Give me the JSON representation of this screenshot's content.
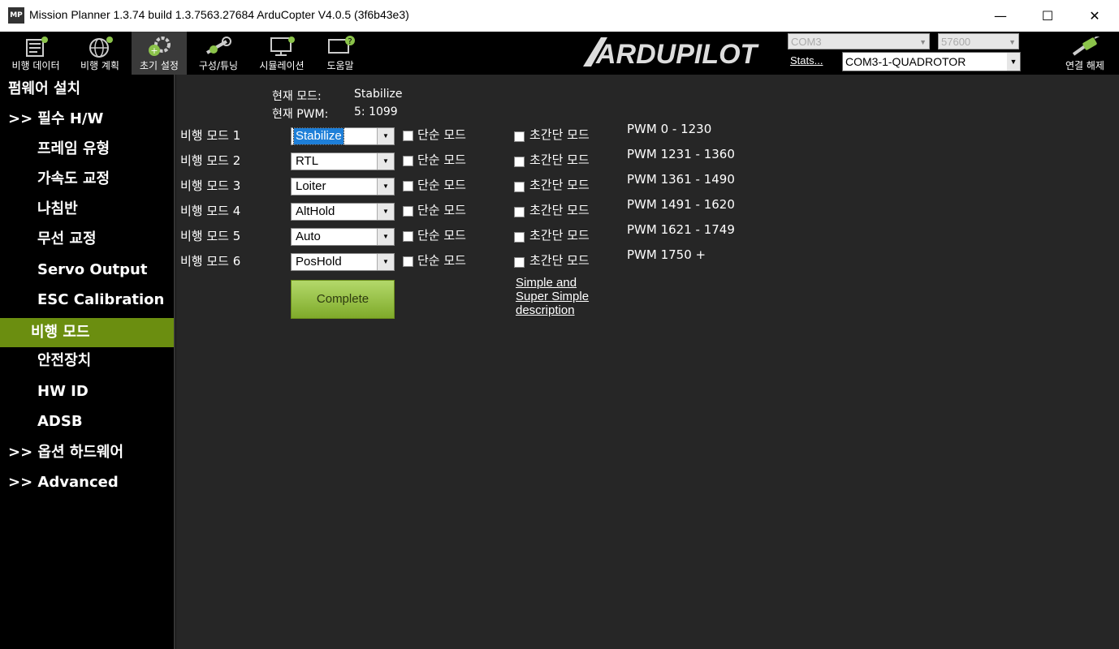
{
  "window": {
    "app_icon_text": "MP",
    "title": "Mission Planner 1.3.74 build 1.3.7563.27684 ArduCopter V4.0.5 (3f6b43e3)",
    "minimize": "—",
    "maximize": "☐",
    "close": "✕"
  },
  "toolbar": {
    "buttons": [
      {
        "label": "비행 데이터",
        "icon": "flight-data-icon"
      },
      {
        "label": "비행 계획",
        "icon": "flight-plan-icon"
      },
      {
        "label": "초기 설정",
        "icon": "initial-setup-icon"
      },
      {
        "label": "구성/튜닝",
        "icon": "config-tuning-icon"
      },
      {
        "label": "시뮬레이션",
        "icon": "simulation-icon"
      },
      {
        "label": "도움말",
        "icon": "help-icon"
      }
    ],
    "active_index": 2,
    "logo_text": "ARDUPILOT",
    "port": "COM3",
    "baud": "57600",
    "stats_link": "Stats...",
    "profile": "COM3-1-QUADROTOR",
    "connect_label": "연결 해제"
  },
  "sidebar": {
    "items": [
      {
        "label": "펌웨어 설치",
        "indent": 0
      },
      {
        "label": ">> 필수 H/W",
        "indent": 0
      },
      {
        "label": "프레임 유형",
        "indent": 1
      },
      {
        "label": "가속도 교정",
        "indent": 1
      },
      {
        "label": "나침반",
        "indent": 1
      },
      {
        "label": "무선 교정",
        "indent": 1
      },
      {
        "label": "Servo Output",
        "indent": 1
      },
      {
        "label": "ESC Calibration",
        "indent": 1
      },
      {
        "label": "비행 모드",
        "indent": 1,
        "selected": true
      },
      {
        "label": "안전장치",
        "indent": 1
      },
      {
        "label": "HW ID",
        "indent": 1
      },
      {
        "label": "ADSB",
        "indent": 1
      },
      {
        "label": ">> 옵션 하드웨어",
        "indent": 0
      },
      {
        "label": ">> Advanced",
        "indent": 0
      }
    ]
  },
  "status": {
    "current_mode_label": "현재 모드:",
    "current_mode_value": "Stabilize",
    "current_pwm_label": "현재 PWM:",
    "current_pwm_value": "5: 1099"
  },
  "modes": [
    {
      "label": "비행 모드 1",
      "value": "Stabilize",
      "simple": "단순 모드",
      "super_simple": "초간단 모드",
      "pwm": "PWM 0 - 1230"
    },
    {
      "label": "비행 모드 2",
      "value": "RTL",
      "simple": "단순 모드",
      "super_simple": "초간단 모드",
      "pwm": "PWM 1231 - 1360"
    },
    {
      "label": "비행 모드 3",
      "value": "Loiter",
      "simple": "단순 모드",
      "super_simple": "초간단 모드",
      "pwm": "PWM 1361 - 1490"
    },
    {
      "label": "비행 모드 4",
      "value": "AltHold",
      "simple": "단순 모드",
      "super_simple": "초간단 모드",
      "pwm": "PWM 1491 - 1620"
    },
    {
      "label": "비행 모드 5",
      "value": "Auto",
      "simple": "단순 모드",
      "super_simple": "초간단 모드",
      "pwm": "PWM 1621 - 1749"
    },
    {
      "label": "비행 모드 6",
      "value": "PosHold",
      "simple": "단순 모드",
      "super_simple": "초간단 모드",
      "pwm": "PWM 1750 +"
    }
  ],
  "complete_label": "Complete",
  "simple_link": [
    "Simple and",
    "Super Simple",
    "description"
  ],
  "colors": {
    "accent": "#6b8e10",
    "panel": "#262626",
    "button": "#9cc84e"
  }
}
